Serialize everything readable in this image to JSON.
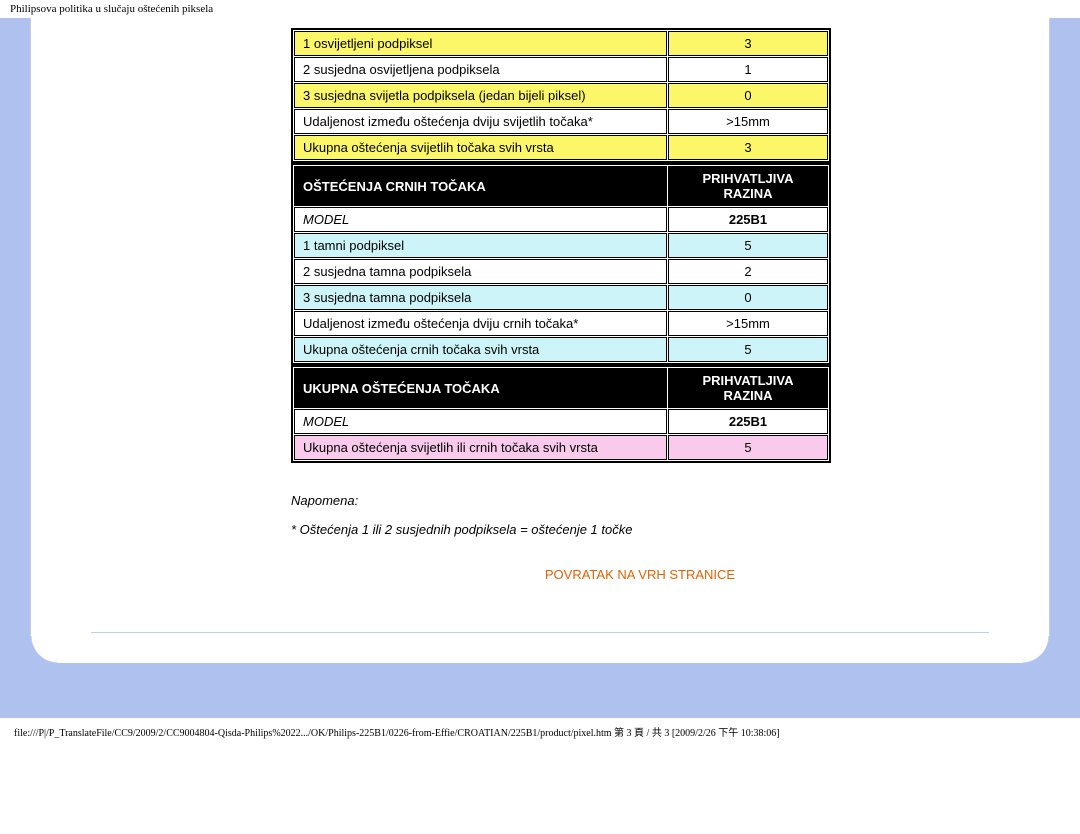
{
  "page_header": "Philipsova politika u slučaju oštećenih piksela",
  "table1": {
    "rows": [
      {
        "cls": "row-yellow",
        "c1": "1 osvijetljeni podpiksel",
        "c2": "3"
      },
      {
        "cls": "row-white",
        "c1": "2 susjedna osvijetljena podpiksela",
        "c2": "1"
      },
      {
        "cls": "row-yellow",
        "c1": "3 susjedna svijetla podpiksela (jedan bijeli piksel)",
        "c2": "0"
      },
      {
        "cls": "row-white",
        "c1": "Udaljenost između oštećenja dviju svijetlih točaka*",
        "c2": ">15mm"
      },
      {
        "cls": "row-yellow",
        "c1": "Ukupna oštećenja svijetlih točaka svih vrsta",
        "c2": "3"
      }
    ]
  },
  "table2": {
    "head_left": "OŠTEĆENJA CRNIH TOČAKA",
    "head_right": "PRIHVATLJIVA RAZINA",
    "model_label": "MODEL",
    "model_value": "225B1",
    "rows": [
      {
        "cls": "row-cyan",
        "c1": "1 tamni podpiksel",
        "c2": "5"
      },
      {
        "cls": "row-white",
        "c1": "2 susjedna tamna podpiksela",
        "c2": "2"
      },
      {
        "cls": "row-cyan",
        "c1": "3 susjedna tamna podpiksela",
        "c2": "0"
      },
      {
        "cls": "row-white",
        "c1": "Udaljenost između oštećenja dviju crnih točaka*",
        "c2": ">15mm"
      },
      {
        "cls": "row-cyan",
        "c1": "Ukupna oštećenja crnih točaka svih vrsta",
        "c2": "5"
      }
    ]
  },
  "table3": {
    "head_left": "UKUPNA OŠTEĆENJA TOČAKA",
    "head_right": "PRIHVATLJIVA RAZINA",
    "model_label": "MODEL",
    "model_value": "225B1",
    "rows": [
      {
        "cls": "row-pink",
        "c1": "Ukupna oštećenja svijetlih ili crnih točaka svih vrsta",
        "c2": "5"
      }
    ]
  },
  "notes": {
    "napomena": "Napomena:",
    "footnote": "* Oštećenja 1 ili 2 susjednih podpiksela = oštećenje 1 točke"
  },
  "back_to_top": "POVRATAK NA VRH STRANICE",
  "footer_path": "file:///P|/P_TranslateFile/CC9/2009/2/CC9004804-Qisda-Philips%2022.../OK/Philips-225B1/0226-from-Effie/CROATIAN/225B1/product/pixel.htm 第 3 頁 / 共 3  [2009/2/26 下午 10:38:06]"
}
